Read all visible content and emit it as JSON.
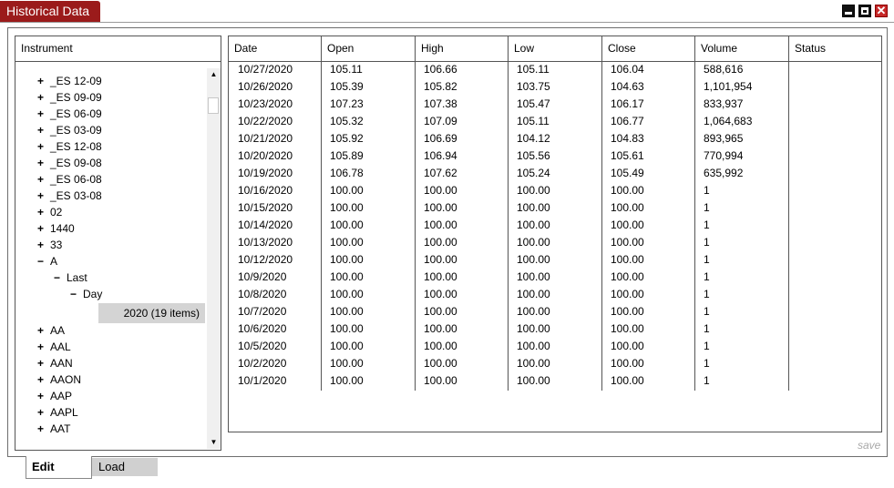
{
  "window": {
    "title": "Historical Data",
    "minimize_icon": "minimize-icon",
    "maximize_icon": "maximize-icon",
    "close_icon": "close-icon",
    "close_glyph": "✕",
    "accent": "#9b1b1b"
  },
  "instrument_panel": {
    "header": "Instrument",
    "tree": [
      {
        "label": "_ES 12-09",
        "expander": "+",
        "level": 0
      },
      {
        "label": "_ES 09-09",
        "expander": "+",
        "level": 0
      },
      {
        "label": "_ES 06-09",
        "expander": "+",
        "level": 0
      },
      {
        "label": "_ES 03-09",
        "expander": "+",
        "level": 0
      },
      {
        "label": "_ES 12-08",
        "expander": "+",
        "level": 0
      },
      {
        "label": "_ES 09-08",
        "expander": "+",
        "level": 0
      },
      {
        "label": "_ES 06-08",
        "expander": "+",
        "level": 0
      },
      {
        "label": "_ES 03-08",
        "expander": "+",
        "level": 0
      },
      {
        "label": "02",
        "expander": "+",
        "level": 0
      },
      {
        "label": "1440",
        "expander": "+",
        "level": 0
      },
      {
        "label": "33",
        "expander": "+",
        "level": 0
      },
      {
        "label": "A",
        "expander": "−",
        "level": 0
      },
      {
        "label": "Last",
        "expander": "−",
        "level": 1
      },
      {
        "label": "Day",
        "expander": "−",
        "level": 2
      },
      {
        "label": "AA",
        "expander": "+",
        "level": 0
      },
      {
        "label": "AAL",
        "expander": "+",
        "level": 0
      },
      {
        "label": "AAN",
        "expander": "+",
        "level": 0
      },
      {
        "label": "AAON",
        "expander": "+",
        "level": 0
      },
      {
        "label": "AAP",
        "expander": "+",
        "level": 0
      },
      {
        "label": "AAPL",
        "expander": "+",
        "level": 0
      },
      {
        "label": "AAT",
        "expander": "+",
        "level": 0
      }
    ],
    "selected_item": "2020 (19 items)",
    "scroll_up_glyph": "▲",
    "scroll_down_glyph": "▼"
  },
  "grid": {
    "columns": [
      "Date",
      "Open",
      "High",
      "Low",
      "Close",
      "Volume",
      "Status"
    ],
    "rows": [
      [
        "10/27/2020",
        "105.11",
        "106.66",
        "105.11",
        "106.04",
        "588,616",
        ""
      ],
      [
        "10/26/2020",
        "105.39",
        "105.82",
        "103.75",
        "104.63",
        "1,101,954",
        ""
      ],
      [
        "10/23/2020",
        "107.23",
        "107.38",
        "105.47",
        "106.17",
        "833,937",
        ""
      ],
      [
        "10/22/2020",
        "105.32",
        "107.09",
        "105.11",
        "106.77",
        "1,064,683",
        ""
      ],
      [
        "10/21/2020",
        "105.92",
        "106.69",
        "104.12",
        "104.83",
        "893,965",
        ""
      ],
      [
        "10/20/2020",
        "105.89",
        "106.94",
        "105.56",
        "105.61",
        "770,994",
        ""
      ],
      [
        "10/19/2020",
        "106.78",
        "107.62",
        "105.24",
        "105.49",
        "635,992",
        ""
      ],
      [
        "10/16/2020",
        "100.00",
        "100.00",
        "100.00",
        "100.00",
        "1",
        ""
      ],
      [
        "10/15/2020",
        "100.00",
        "100.00",
        "100.00",
        "100.00",
        "1",
        ""
      ],
      [
        "10/14/2020",
        "100.00",
        "100.00",
        "100.00",
        "100.00",
        "1",
        ""
      ],
      [
        "10/13/2020",
        "100.00",
        "100.00",
        "100.00",
        "100.00",
        "1",
        ""
      ],
      [
        "10/12/2020",
        "100.00",
        "100.00",
        "100.00",
        "100.00",
        "1",
        ""
      ],
      [
        "10/9/2020",
        "100.00",
        "100.00",
        "100.00",
        "100.00",
        "1",
        ""
      ],
      [
        "10/8/2020",
        "100.00",
        "100.00",
        "100.00",
        "100.00",
        "1",
        ""
      ],
      [
        "10/7/2020",
        "100.00",
        "100.00",
        "100.00",
        "100.00",
        "1",
        ""
      ],
      [
        "10/6/2020",
        "100.00",
        "100.00",
        "100.00",
        "100.00",
        "1",
        ""
      ],
      [
        "10/5/2020",
        "100.00",
        "100.00",
        "100.00",
        "100.00",
        "1",
        ""
      ],
      [
        "10/2/2020",
        "100.00",
        "100.00",
        "100.00",
        "100.00",
        "1",
        ""
      ],
      [
        "10/1/2020",
        "100.00",
        "100.00",
        "100.00",
        "100.00",
        "1",
        ""
      ]
    ]
  },
  "footer": {
    "save_label": "save",
    "tabs": [
      {
        "label": "Edit",
        "active": true
      },
      {
        "label": "Load",
        "active": false
      }
    ]
  }
}
